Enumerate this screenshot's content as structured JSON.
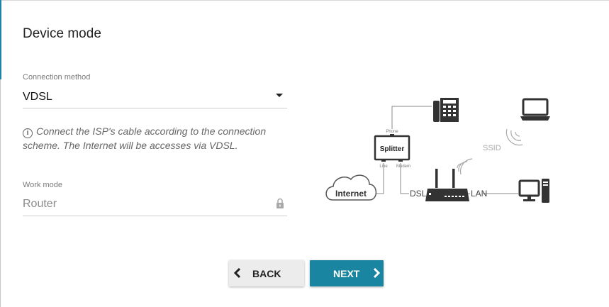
{
  "page": {
    "title": "Device mode"
  },
  "connection": {
    "label": "Connection method",
    "value": "VDSL"
  },
  "info": {
    "text": "Connect the ISP's cable according to the connection scheme. The Internet will be accesses via VDSL."
  },
  "work_mode": {
    "label": "Work mode",
    "value": "Router"
  },
  "diagram": {
    "phone_label": "Phone",
    "splitter_label": "Splitter",
    "line_label": "Line",
    "modem_label": "Modem",
    "internet_label": "Internet",
    "dsl_label": "DSL",
    "lan_label": "LAN",
    "ssid_label": "SSID"
  },
  "buttons": {
    "back": "BACK",
    "next": "NEXT"
  },
  "colors": {
    "accent": "#1a85a0",
    "back_bg": "#ececec"
  }
}
